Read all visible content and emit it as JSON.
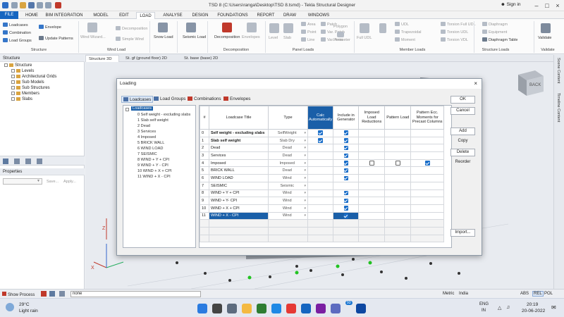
{
  "window": {
    "title": "TSD 8 (C:\\Users\\ranga\\Desktop\\TSD 8.tsmd) - Tekla Structural Designer",
    "sign_in": "Sign in"
  },
  "menu": {
    "tabs": [
      "FILE",
      "HOME",
      "BIM INTEGRATION",
      "MODEL",
      "EDIT",
      "LOAD",
      "ANALYSE",
      "DESIGN",
      "FOUNDATIONS",
      "REPORT",
      "DRAW",
      "WINDOWS"
    ],
    "active": "LOAD"
  },
  "ribbon": {
    "structure": {
      "loadcases": "Loadcases",
      "combination": "Combination",
      "load_groups": "Load Groups",
      "envelope": "Envelope",
      "update_patterns": "Update Patterns",
      "label": "Structure"
    },
    "wind": {
      "wind_wizard": "Wind Wizard...",
      "decomposition": "Decomposition",
      "simple_wind": "Simple Wind",
      "label": "Wind Load"
    },
    "snow": {
      "snow_load": "Snow Load"
    },
    "seismic": {
      "seismic_load": "Seismic Load"
    },
    "decomp": {
      "decomposition": "Decomposition",
      "envelopes": "Envelopes",
      "label": "Decomposition"
    },
    "panel": {
      "level": "Level",
      "slab": "Slab",
      "area": "Area",
      "point": "Point",
      "line": "Line",
      "patch": "Patch",
      "var_patch": "Var. Patch",
      "var_area": "Var. Area",
      "polygon": "Polygon",
      "perimeter": "Perimeter",
      "label": "Panel Loads"
    },
    "member": {
      "full_udl": "Full UDL",
      "udl": "UDL",
      "trapezoidal": "Trapezoidal",
      "moment": "Moment",
      "torsion_full_udl": "Torsion Full UDL",
      "torsion_udl": "Torsion UDL",
      "torsion_vdl": "Torsion VDL",
      "label": "Member Loads"
    },
    "structure_loads": {
      "diaphragm": "Diaphragm",
      "equipment": "Equipment",
      "diaphragm_table": "Diaphragm Table",
      "label": "Structure Loads"
    },
    "validate": {
      "validate": "Validate",
      "label": "Validate"
    }
  },
  "view_tabs": [
    "Structure 3D",
    "St. gf (ground floor) 2D",
    "St. base (base) 2D"
  ],
  "structure_panel": {
    "title": "Structure",
    "root": "Structure",
    "items": [
      "Levels",
      "Architectural Grids",
      "Sub Models",
      "Sub Structures",
      "Members",
      "Slabs"
    ]
  },
  "properties_panel": {
    "title": "Properties",
    "save": "Save...",
    "apply": "Apply..."
  },
  "right_strip": {
    "scene_content": "Scene Content",
    "timeline_content": "Timeline Content"
  },
  "nav_cube": {
    "face": "BACK"
  },
  "dialog": {
    "title": "Loading",
    "tabs": [
      "Loadcases",
      "Load Groups",
      "Combinations",
      "Envelopes"
    ],
    "tree_root": "Loadcases",
    "tree_items": [
      "0 Self weight - excluding slabs",
      "1 Slab self weight",
      "2 Dead",
      "3 Services",
      "4 Imposed",
      "5 BRICK WALL",
      "6 WIND LOAD",
      "7 SEISMIC",
      "8 WIND + Y + CPI",
      "9 WIND + Y - CPI",
      "10 WIND + X + CPI",
      "11 WIND + X - CPI"
    ],
    "columns": [
      "#",
      "Loadcase Title",
      "Type",
      "Calc Automatically",
      "Include in Generator",
      "Imposed Load Reductions",
      "Pattern Load",
      "Pattern Ecc. Moments for Precast Columns"
    ],
    "rows": [
      {
        "num": "0",
        "title": "Self weight - excluding slabs",
        "type": "SelfWeight",
        "calc": true,
        "gen": true,
        "imp": null,
        "pat": null,
        "ecc": null,
        "bold": true
      },
      {
        "num": "1",
        "title": "Slab self weight",
        "type": "Slab Dry",
        "calc": true,
        "gen": true,
        "imp": null,
        "pat": null,
        "ecc": null,
        "bold": true
      },
      {
        "num": "2",
        "title": "Dead",
        "type": "Dead",
        "calc": null,
        "gen": true,
        "imp": null,
        "pat": null,
        "ecc": null
      },
      {
        "num": "3",
        "title": "Services",
        "type": "Dead",
        "calc": null,
        "gen": true,
        "imp": null,
        "pat": null,
        "ecc": null
      },
      {
        "num": "4",
        "title": "Imposed",
        "type": "Imposed",
        "calc": null,
        "gen": true,
        "imp": false,
        "pat": false,
        "ecc": true
      },
      {
        "num": "5",
        "title": "BRICK WALL",
        "type": "Dead",
        "calc": null,
        "gen": true,
        "imp": null,
        "pat": null,
        "ecc": null
      },
      {
        "num": "6",
        "title": "WIND LOAD",
        "type": "Wind",
        "calc": null,
        "gen": true,
        "imp": null,
        "pat": null,
        "ecc": null
      },
      {
        "num": "7",
        "title": "SEISMIC",
        "type": "Seismic",
        "calc": null,
        "gen": null,
        "imp": null,
        "pat": null,
        "ecc": null
      },
      {
        "num": "8",
        "title": "WIND + Y + CPI",
        "type": "Wind",
        "calc": null,
        "gen": true,
        "imp": null,
        "pat": null,
        "ecc": null
      },
      {
        "num": "9",
        "title": "WIND + Y- CPI",
        "type": "Wind",
        "calc": null,
        "gen": true,
        "imp": null,
        "pat": null,
        "ecc": null
      },
      {
        "num": "10",
        "title": "WIND + X + CPI",
        "type": "Wind",
        "calc": null,
        "gen": true,
        "imp": null,
        "pat": null,
        "ecc": null
      },
      {
        "num": "11",
        "title": "WIND + X - CPI",
        "type": "Wind",
        "calc": null,
        "gen": true,
        "imp": null,
        "pat": null,
        "ecc": null,
        "selected": true
      }
    ],
    "buttons": {
      "ok": "OK",
      "cancel": "Cancel",
      "add": "Add",
      "copy": "Copy",
      "delete": "Delete",
      "reorder": "Reorder",
      "import": "Import..."
    }
  },
  "status": {
    "show_process": "Show Process",
    "search_value": "none",
    "units": "Metric",
    "region": "India",
    "modes": [
      "ABS",
      "REL",
      "POL"
    ]
  },
  "taskbar": {
    "temp": "29°C",
    "weather": "Light rain",
    "lang1": "ENG",
    "lang2": "IN",
    "time": "20:19",
    "date": "20-06-2022",
    "badge": "93"
  }
}
